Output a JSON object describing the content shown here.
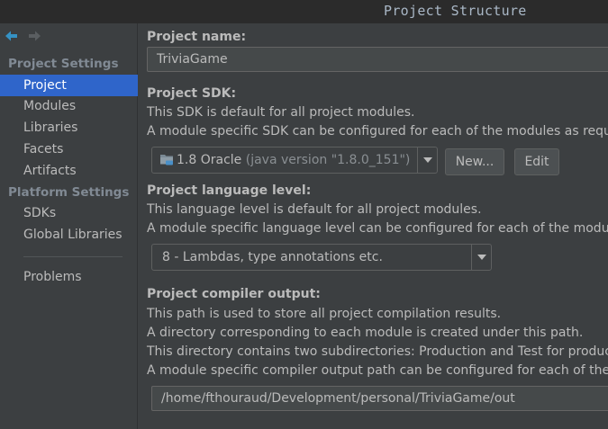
{
  "window": {
    "title": "Project Structure"
  },
  "sidebar": {
    "project_settings_header": "Project Settings",
    "project_settings_items": [
      "Project",
      "Modules",
      "Libraries",
      "Facets",
      "Artifacts"
    ],
    "platform_settings_header": "Platform Settings",
    "platform_settings_items": [
      "SDKs",
      "Global Libraries"
    ],
    "problems": "Problems",
    "selected": "Project"
  },
  "project": {
    "name_label": "Project name:",
    "name_value": "TriviaGame",
    "sdk_label": "Project SDK:",
    "sdk_desc_1": "This SDK is default for all project modules.",
    "sdk_desc_2": "A module specific SDK can be configured for each of the modules as required.",
    "sdk_name": "1.8 Oracle",
    "sdk_version": "(java version \"1.8.0_151\")",
    "new_button": "New...",
    "edit_button": "Edit",
    "lang_label": "Project language level:",
    "lang_desc_1": "This language level is default for all project modules.",
    "lang_desc_2": "A module specific language level can be configured for each of the modules as required.",
    "lang_value": "8 - Lambdas, type annotations etc.",
    "output_label": "Project compiler output:",
    "output_desc_1": "This path is used to store all project compilation results.",
    "output_desc_2": "A directory corresponding to each module is created under this path.",
    "output_desc_3": "This directory contains two subdirectories: Production and Test for production code and test sources, respectively.",
    "output_desc_4": "A module specific compiler output path can be configured for each of the modules as required.",
    "output_value": "/home/fthouraud/Development/personal/TriviaGame/out"
  },
  "colors": {
    "background": "#3c3f41",
    "selection": "#2f65ca",
    "back_arrow": "#3592c4"
  }
}
